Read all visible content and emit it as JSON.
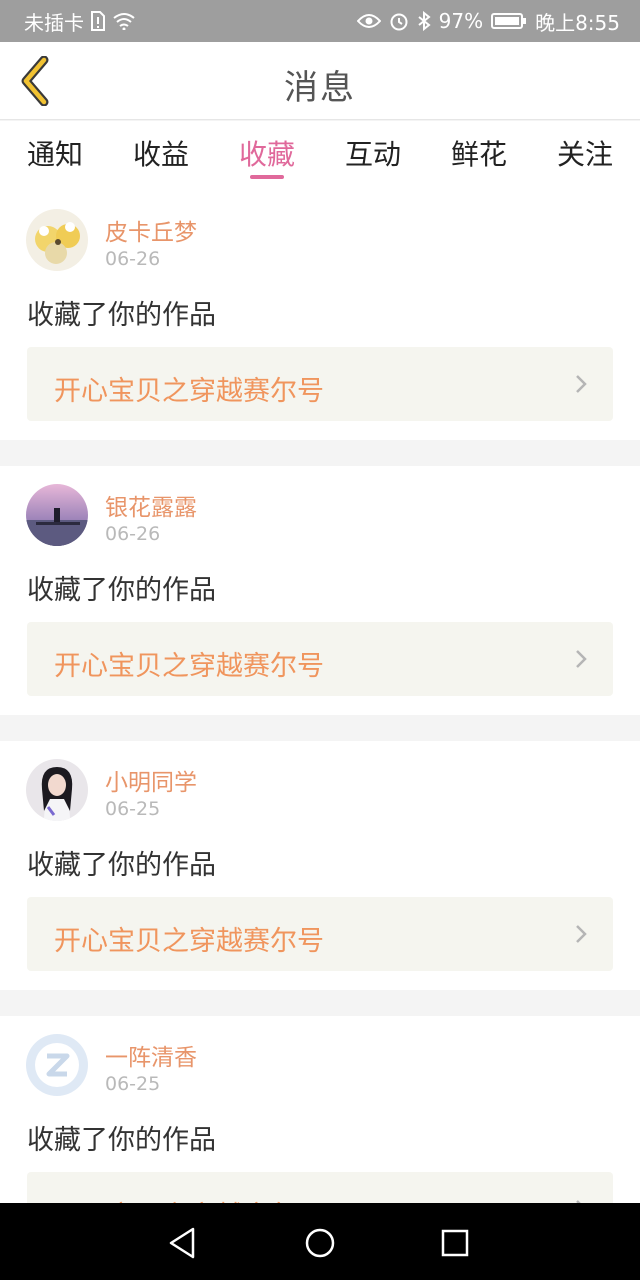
{
  "status_bar": {
    "carrier": "未插卡",
    "battery": "97%",
    "time": "晚上8:55",
    "icons": [
      "sim-alert-icon",
      "wifi-icon",
      "eye-icon",
      "alarm-icon",
      "bluetooth-icon",
      "battery-icon"
    ]
  },
  "header": {
    "title": "消息",
    "back_icon": "back-chevron-icon"
  },
  "tabs": [
    {
      "label": "通知",
      "active": false
    },
    {
      "label": "收益",
      "active": false
    },
    {
      "label": "收藏",
      "active": true
    },
    {
      "label": "互动",
      "active": false
    },
    {
      "label": "鲜花",
      "active": false
    },
    {
      "label": "关注",
      "active": false
    }
  ],
  "messages": [
    {
      "user": "皮卡丘梦",
      "date": "06-26",
      "text": "收藏了你的作品",
      "work": "开心宝贝之穿越赛尔号"
    },
    {
      "user": "银花露露",
      "date": "06-26",
      "text": "收藏了你的作品",
      "work": "开心宝贝之穿越赛尔号"
    },
    {
      "user": "小明同学",
      "date": "06-25",
      "text": "收藏了你的作品",
      "work": "开心宝贝之穿越赛尔号"
    },
    {
      "user": "一阵清香",
      "date": "06-25",
      "text": "收藏了你的作品",
      "work": "开心宝贝之穿越赛尔号"
    }
  ],
  "nav_bar": {
    "icons": [
      "back-triangle-icon",
      "home-circle-icon",
      "recents-square-icon"
    ]
  },
  "colors": {
    "accent": "#e0699b",
    "name": "#e8956a",
    "work_title": "#f0955d",
    "status_bar": "#9e9e9e"
  }
}
